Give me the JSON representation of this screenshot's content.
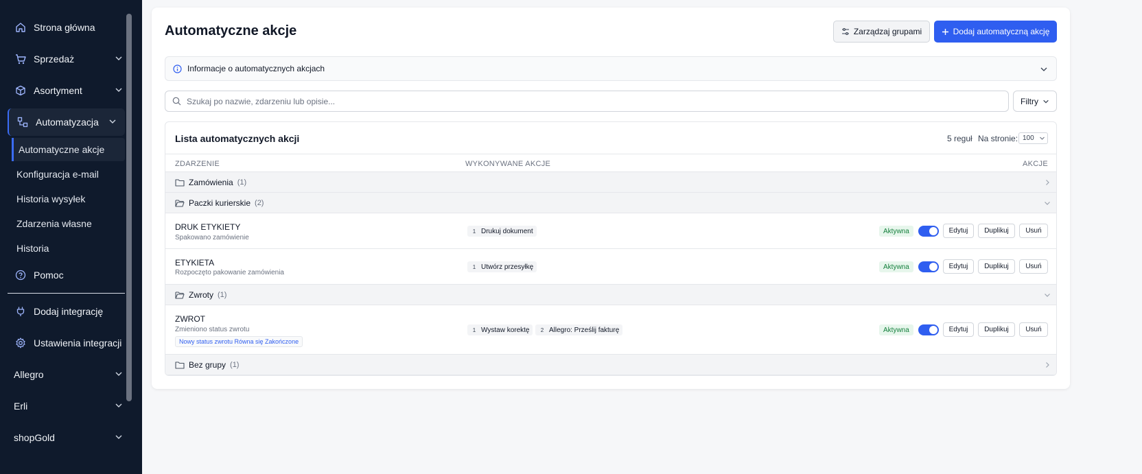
{
  "sidebar": {
    "items": [
      {
        "label": "Strona główna",
        "icon": "home-icon"
      },
      {
        "label": "Sprzedaż",
        "icon": "cart-icon"
      },
      {
        "label": "Asortyment",
        "icon": "box-icon"
      },
      {
        "label": "Automatyzacja",
        "icon": "automation-icon"
      }
    ],
    "subitems": [
      "Automatyczne akcje",
      "Konfiguracja e-mail",
      "Historia wysyłek",
      "Zdarzenia własne",
      "Historia"
    ],
    "help_label": "Pomoc",
    "add_integration_label": "Dodaj integrację",
    "integration_settings_label": "Ustawienia integracji",
    "groups": [
      "Allegro",
      "Erli",
      "shopGold"
    ]
  },
  "header": {
    "title": "Automatyczne akcje",
    "manage_groups_label": "Zarządzaj grupami",
    "add_action_label": "Dodaj automatyczną akcję"
  },
  "info": {
    "label": "Informacje o automatycznych akcjach"
  },
  "search": {
    "placeholder": "Szukaj po nazwie, zdarzeniu lub opisie...",
    "filters_label": "Filtry"
  },
  "list": {
    "title": "Lista automatycznych akcji",
    "rules_count": "5 reguł",
    "per_page_label": "Na stronie:",
    "per_page_value": "100",
    "columns": {
      "event": "ZDARZENIE",
      "actions": "WYKONYWANE AKCJE",
      "controls": "AKCJE"
    },
    "groups": [
      {
        "name": "Zamówienia",
        "count": "(1)"
      },
      {
        "name": "Paczki kurierskie",
        "count": "(2)"
      },
      {
        "name": "Zwroty",
        "count": "(1)"
      },
      {
        "name": "Bez grupy",
        "count": "(1)"
      }
    ],
    "rules": [
      {
        "name": "DRUK ETYKIETY",
        "event": "Spakowano zamówienie",
        "actions": [
          {
            "num": "1",
            "label": "Drukuj dokument"
          }
        ],
        "status": "Aktywna"
      },
      {
        "name": "ETYKIETA",
        "event": "Rozpoczęto pakowanie zamówienia",
        "actions": [
          {
            "num": "1",
            "label": "Utwórz przesyłkę"
          }
        ],
        "status": "Aktywna"
      },
      {
        "name": "ZWROT",
        "event": "Zmieniono status zwrotu",
        "condition": "Nowy status zwrotu Równa się Zakończone",
        "actions": [
          {
            "num": "1",
            "label": "Wystaw korektę"
          },
          {
            "num": "2",
            "label": "Allegro: Prześlij fakturę"
          }
        ],
        "status": "Aktywna"
      }
    ],
    "buttons": {
      "edit": "Edytuj",
      "duplicate": "Duplikuj",
      "delete": "Usuń"
    }
  },
  "colors": {
    "accent": "#2f5ef0",
    "sidebar_bg": "#0f1a2c",
    "active_green": "#15803d"
  }
}
